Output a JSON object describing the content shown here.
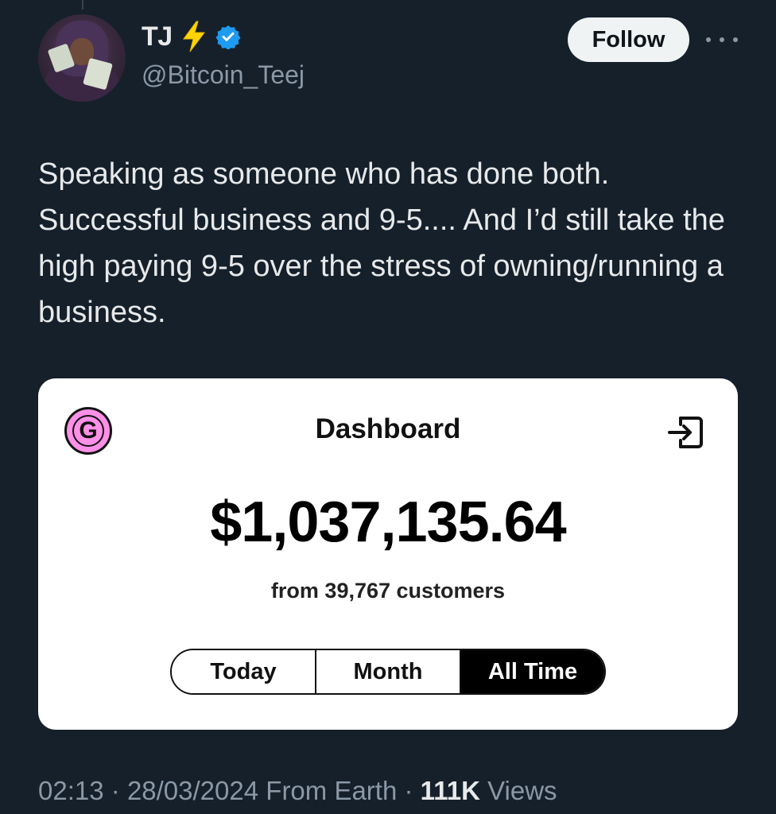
{
  "author": {
    "display_name": "TJ",
    "handle": "@Bitcoin_Teej",
    "badges": [
      "lightning-bolt",
      "verified-badge"
    ]
  },
  "actions": {
    "follow_label": "Follow"
  },
  "tweet": {
    "text": "Speaking as someone who has done both. Successful business and 9-5.... And I’d still take the high paying 9-5 over the stress of owning/running a business."
  },
  "media": {
    "logo_letter": "G",
    "title": "Dashboard",
    "amount": "$1,037,135.64",
    "subtitle": "from 39,767 customers",
    "tabs": [
      {
        "label": "Today",
        "selected": false
      },
      {
        "label": "Month",
        "selected": false
      },
      {
        "label": "All Time",
        "selected": true
      }
    ]
  },
  "meta": {
    "time": "02:13",
    "date": "28/03/2024",
    "source": "From Earth",
    "views_count": "111K",
    "views_label": "Views"
  },
  "colors": {
    "background": "#15202b",
    "text": "#e7e9ea",
    "secondary_text": "#8b98a5",
    "verified": "#1d9bf0",
    "brand_pink": "#ff90e8",
    "bolt": "#ffd400"
  }
}
